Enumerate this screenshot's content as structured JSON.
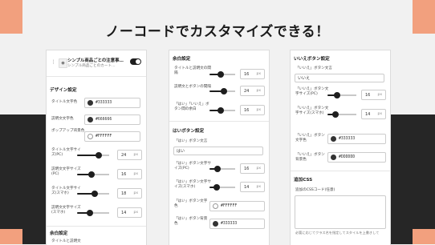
{
  "headline": "ノーコードでカスタマイズできる！",
  "panel1": {
    "plugin_title": "シンプル商品ごとの注意事…",
    "plugin_subtitle": "シンプル商品ごとのカート…",
    "design_heading": "デザイン設定",
    "title_color_label": "タイトル文字色",
    "title_color_value": "#333333",
    "desc_color_label": "説明文文字色",
    "desc_color_value": "#666666",
    "popup_bg_label": "ポップアップ背景色",
    "popup_bg_value": "#FFFFFF",
    "title_size_pc_label": "タイトル文字サイズ(PC)",
    "title_size_pc_value": "24",
    "desc_size_pc_label": "説明文文字サイズ(PC)",
    "desc_size_pc_value": "16",
    "title_size_sp_label": "タイトル文字サイズ(スマホ)",
    "title_size_sp_value": "18",
    "desc_size_sp_label": "説明文文字サイズ(スマホ)",
    "desc_size_sp_value": "14",
    "margin_heading": "余白設定",
    "bottom_cut_label": "タイトルと説明文",
    "unit": "px"
  },
  "panel2": {
    "margin_heading": "余白設定",
    "gap1_label": "タイトルと説明文の間隔",
    "gap1_value": "16",
    "gap2_label": "説明文とボタンの間隔",
    "gap2_value": "24",
    "gap3_label": "「はい」「いいえ」ボタン間の余白",
    "gap3_value": "16",
    "yes_heading": "はいボタン設定",
    "yes_text_label": "「はい」ボタン文言",
    "yes_text_value": "はい",
    "yes_size_pc_label": "「はい」ボタン文字サイズ(PC)",
    "yes_size_pc_value": "16",
    "yes_size_sp_label": "「はい」ボタン文字サイズ(スマホ)",
    "yes_size_sp_value": "14",
    "yes_color_label": "「はい」ボタン文字色",
    "yes_color_value": "#FFFFFF",
    "yes_bg_label": "「はい」ボタン背景色",
    "yes_bg_value": "#333333",
    "unit": "px"
  },
  "panel3": {
    "no_heading": "いいえボタン設定",
    "no_text_label": "「いいえ」ボタン文言",
    "no_text_value": "いいえ",
    "no_size_pc_label": "「いいえ」ボタン文字サイズ(PC)",
    "no_size_pc_value": "16",
    "no_size_sp_label": "「いいえ」ボタン文字サイズ(スマホ)",
    "no_size_sp_value": "14",
    "no_color_label": "「いいえ」ボタン文字色",
    "no_color_value": "#333333",
    "no_bg_label": "「いいえ」ボタン背景色",
    "no_bg_value": "#DDDDDD",
    "css_heading": "追加CSS",
    "css_label": "追加のCSSコード(任意)",
    "css_note": "必要に応じてクラス名を指定してスタイルを上書きして",
    "unit": "px"
  },
  "colors": {
    "accent_salmon": "#f2a07e",
    "dark": "#262626"
  }
}
